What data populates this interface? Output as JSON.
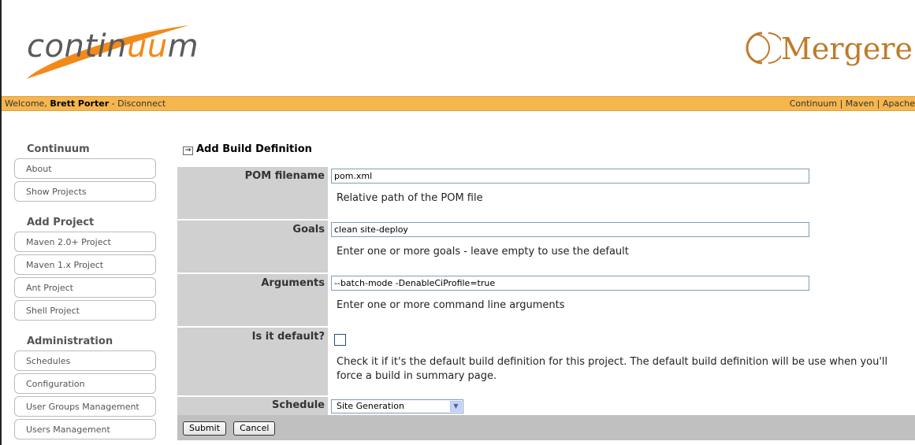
{
  "header": {
    "continuum_logo_prefix": "contin",
    "continuum_logo_highlight": "uu",
    "continuum_logo_suffix": "m",
    "mergere_logo_text": "Mergere"
  },
  "welcome_bar": {
    "welcome_text": "Welcome, ",
    "user_name": "Brett Porter",
    "separator": " - ",
    "disconnect_label": "Disconnect",
    "right_links_text": "Continuum | Maven | Apache"
  },
  "sidebar": {
    "sections": [
      {
        "heading": "Continuum",
        "items": [
          "About",
          "Show Projects"
        ]
      },
      {
        "heading": "Add Project",
        "items": [
          "Maven 2.0+ Project",
          "Maven 1.x Project",
          "Ant Project",
          "Shell Project"
        ]
      },
      {
        "heading": "Administration",
        "items": [
          "Schedules",
          "Configuration",
          "User Groups Management",
          "Users Management"
        ]
      }
    ]
  },
  "main": {
    "title": "Add Build Definition",
    "pom": {
      "label": "POM filename",
      "value": "pom.xml",
      "hint": "Relative path of the POM file"
    },
    "goals": {
      "label": "Goals",
      "value": "clean site-deploy",
      "hint": "Enter one or more goals - leave empty to use the default"
    },
    "arguments": {
      "label": "Arguments",
      "value": "--batch-mode -DenableCiProfile=true",
      "hint": "Enter one or more command line arguments"
    },
    "is_default": {
      "label": "Is it default?",
      "checked": false,
      "hint": "Check it if it's the default build definition for this project. The default build definition will be use when you'll force a build in summary page."
    },
    "schedule": {
      "label": "Schedule",
      "selected": "Site Generation"
    },
    "submit_label": "Submit",
    "cancel_label": "Cancel"
  },
  "colors": {
    "welcome_bar": "#f5b64e",
    "label_cell": "#d0d0d0",
    "button_row": "#c0c0c0",
    "logo_orange": "#f28a1a"
  }
}
